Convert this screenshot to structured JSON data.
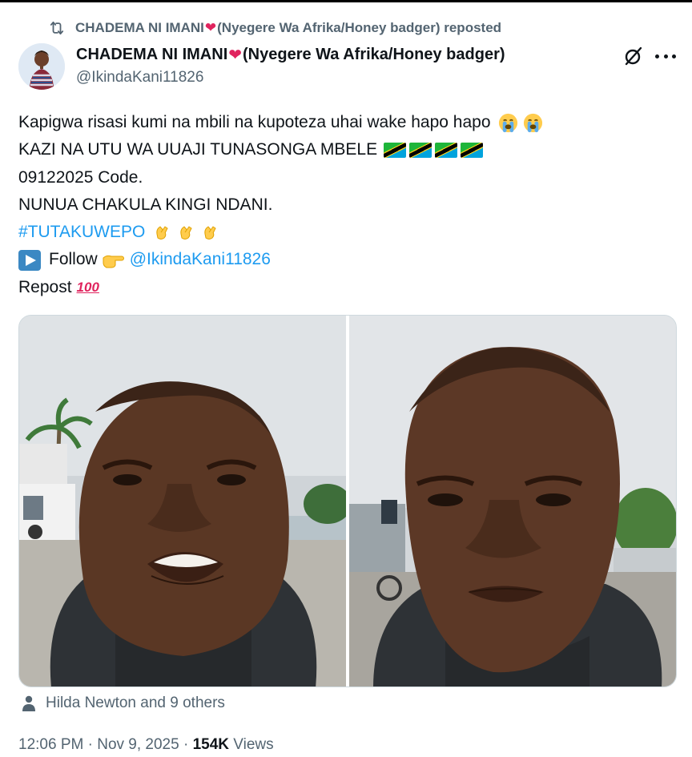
{
  "repost": {
    "name_part1": "CHADEMA NI IMANI",
    "name_part2": "(Nyegere Wa Afrika/Honey badger)",
    "suffix": "reposted"
  },
  "author": {
    "name_part1": "CHADEMA NI IMANI",
    "name_part2": "(Nyegere Wa Afrika/Honey badger)",
    "handle": "@IkindaKani11826"
  },
  "post": {
    "line1": "Kapigwa risasi kumi na mbili na kupoteza uhai wake hapo hapo",
    "line2": "KAZI NA UTU WA UUAJI TUNASONGA MBELE",
    "line3": "09122025 Code.",
    "line4": "NUNUA CHAKULA KINGI NDANI.",
    "hashtag": "#TUTAKUWEPO",
    "follow_label": "Follow",
    "follow_handle": "@IkindaKani11826",
    "repost_label": "Repost",
    "hundred": "100"
  },
  "icons": {
    "repost": "repost-icon",
    "grok": "grok-icon",
    "more": "more-icon",
    "play": "play-button-emoji-icon",
    "point": "backhand-index-pointing-right-emoji",
    "clap": "clapping-hands-emoji",
    "cry": "loudly-crying-face-emoji",
    "flag": "tanzania-flag-emoji",
    "person": "person-icon"
  },
  "liked_by": "Hilda Newton and 9 others",
  "meta": {
    "time": "12:06 PM",
    "date": "Nov 9, 2025",
    "views_count": "154K",
    "views_label": "Views"
  },
  "colors": {
    "link": "#1d9bf0",
    "secondary_text": "#536471",
    "primary_text": "#0f1419",
    "heart": "#e0245e"
  }
}
